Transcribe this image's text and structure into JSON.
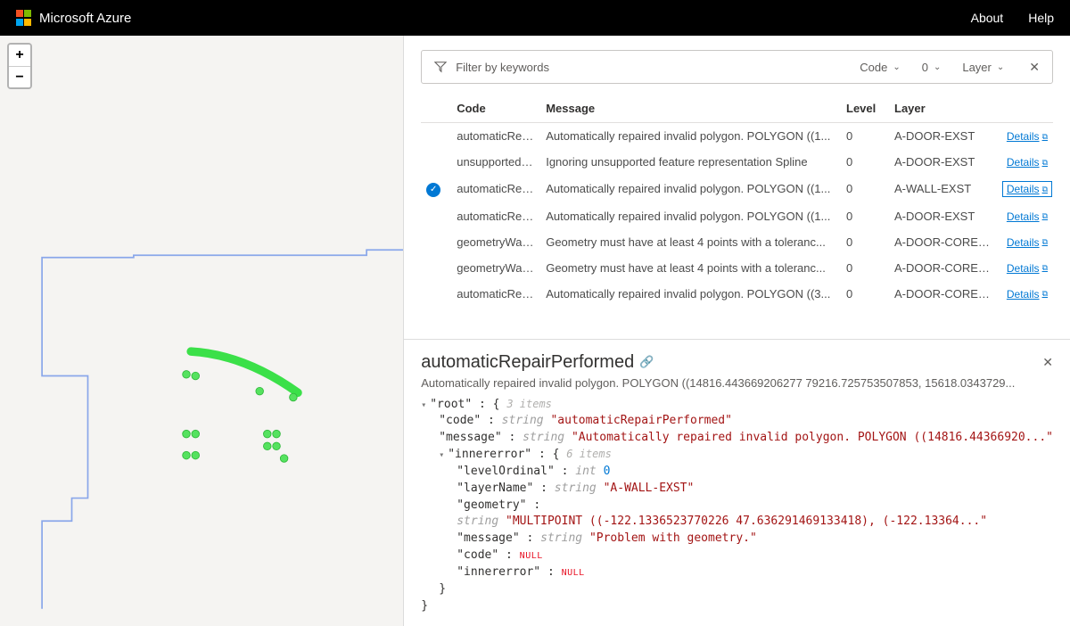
{
  "header": {
    "brand": "Microsoft Azure",
    "nav": {
      "about": "About",
      "help": "Help"
    },
    "logo_colors": [
      "#F25022",
      "#7FBA00",
      "#00A4EF",
      "#FFB900"
    ]
  },
  "map": {
    "zoom_in": "+",
    "zoom_out": "−"
  },
  "filter": {
    "placeholder": "Filter by keywords",
    "code_label": "Code",
    "level_value": "0",
    "layer_label": "Layer"
  },
  "columns": {
    "code": "Code",
    "message": "Message",
    "level": "Level",
    "layer": "Layer"
  },
  "detail_link_label": "Details",
  "rows": [
    {
      "code": "automaticRepair...",
      "message": "Automatically repaired invalid polygon. POLYGON ((1...",
      "level": "0",
      "layer": "A-DOOR-EXST",
      "selected": false
    },
    {
      "code": "unsupportedFeat...",
      "message": "Ignoring unsupported feature representation Spline",
      "level": "0",
      "layer": "A-DOOR-EXST",
      "selected": false
    },
    {
      "code": "automaticRepair...",
      "message": "Automatically repaired invalid polygon. POLYGON ((1...",
      "level": "0",
      "layer": "A-WALL-EXST",
      "selected": true
    },
    {
      "code": "automaticRepair...",
      "message": "Automatically repaired invalid polygon. POLYGON ((1...",
      "level": "0",
      "layer": "A-DOOR-EXST",
      "selected": false
    },
    {
      "code": "geometryWarning",
      "message": "Geometry must have at least 4 points with a toleranc...",
      "level": "0",
      "layer": "A-DOOR-CORE-EXST",
      "selected": false
    },
    {
      "code": "geometryWarning",
      "message": "Geometry must have at least 4 points with a toleranc...",
      "level": "0",
      "layer": "A-DOOR-CORE-EXST",
      "selected": false
    },
    {
      "code": "automaticRepair...",
      "message": "Automatically repaired invalid polygon. POLYGON ((3...",
      "level": "0",
      "layer": "A-DOOR-CORE-EXST",
      "selected": false
    }
  ],
  "detail": {
    "title": "automaticRepairPerformed",
    "subtitle": "Automatically repaired invalid polygon. POLYGON ((14816.443669206277 79216.725753507853, 15618.0343729...",
    "json": {
      "root_label": "\"root\"",
      "root_count": "3 items",
      "code_key": "\"code\"",
      "code_val": "\"automaticRepairPerformed\"",
      "message_key": "\"message\"",
      "message_val": "\"Automatically repaired invalid polygon. POLYGON ((14816.44366920...\"",
      "inner_key": "\"innererror\"",
      "inner_count": "6 items",
      "level_key": "\"levelOrdinal\"",
      "level_val": "0",
      "layer_key": "\"layerName\"",
      "layer_val": "\"A-WALL-EXST\"",
      "geom_key": "\"geometry\"",
      "geom_val": "\"MULTIPOINT ((-122.1336523770226 47.636291469133418), (-122.13364...\"",
      "imsg_key": "\"message\"",
      "imsg_val": "\"Problem with geometry.\"",
      "icode_key": "\"code\"",
      "ierr_key": "\"innererror\"",
      "null": "NULL",
      "type_string": "string",
      "type_int": "int"
    }
  }
}
